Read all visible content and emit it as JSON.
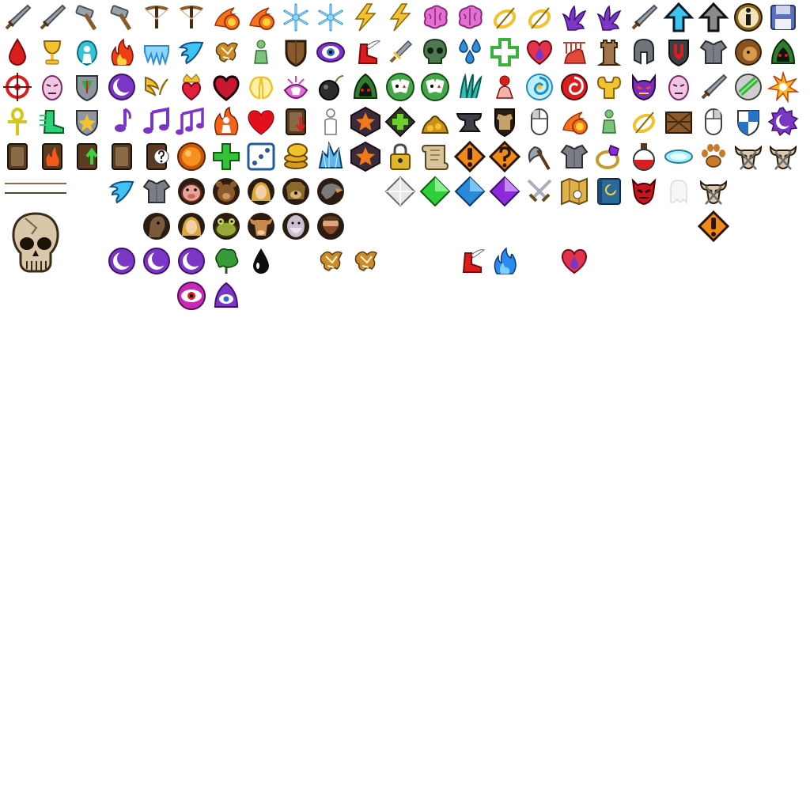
{
  "sheet": {
    "background": "#ffffff",
    "rows": [
      {
        "row": "row-1",
        "icons": [
          "sword-icon",
          "sword-icon",
          "hammer-icon",
          "hammer-icon",
          "crossbow-icon",
          "crossbow-icon",
          "fireball-icon",
          "fireball-icon",
          "snowflake-icon",
          "snowflake-icon",
          "lightning-icon",
          "lightning-icon",
          "brain-icon",
          "brain-icon",
          "ring-icon",
          "ring-icon",
          "coral-icon",
          "coral-icon",
          "sword-icon",
          "arrow-up-blue-icon",
          "arrow-up-gray-icon",
          "info-icon",
          "save-disk-icon"
        ]
      },
      {
        "row": "row-2",
        "icons": [
          "blood-drop-icon",
          "chalice-icon",
          "angel-icon",
          "fire-icon",
          "ice-icon",
          "wing-icon",
          "rune-icon",
          "figure-icon",
          "wooden-shield-icon",
          "eye-icon",
          "winged-boot-icon",
          "dagger-icon",
          "skull-icon",
          "water-drops-icon",
          "cross-icon",
          "heart-potion-icon",
          "torture-icon",
          "tower-icon",
          "helmet-icon",
          "banner-shield-icon",
          "armor-icon",
          "lion-icon",
          "hood-icon"
        ]
      },
      {
        "row": "row-3",
        "icons": [
          "target-icon",
          "face-icon",
          "shield-icon",
          "moon-icon",
          "wings-icon",
          "heart-crown-icon",
          "dark-heart-icon",
          "angel-wings-icon",
          "magic-hand-icon",
          "bomb-icon",
          "hood-icon",
          "cards-icon",
          "cards-icon",
          "feathers-icon",
          "stand-icon",
          "swirl-icon",
          "spiral-icon",
          "strength-icon",
          "demon-icon",
          "face-icon",
          "sword-icon",
          "chain-icon",
          "burst-icon"
        ]
      },
      {
        "row": "row-4",
        "icons": [
          "ankh-icon",
          "boot-icon",
          "shield-star-icon",
          "music-note-icon",
          "music-notes-icon",
          "music-triple-icon",
          "flame-figure-icon",
          "heart-icon",
          "card-down-icon",
          "silhouette-icon",
          "star-icon",
          "plus-diamond-icon",
          "gold-pile-icon",
          "anvil-icon",
          "armor-badge-icon",
          "mouse-left-icon",
          "fireball-icon",
          "figure-icon",
          "ring-icon",
          "crate-icon",
          "mouse-right-icon",
          "heater-shield-icon",
          "gear-moon-icon"
        ]
      },
      {
        "row": "row-5",
        "icons": [
          "card-icon",
          "card-fire-icon",
          "card-up-icon",
          "card-icon",
          "card-question-icon",
          "orb-icon",
          "plus-icon",
          "dice-icon",
          "coins-icon",
          "crystal-icon",
          "star-icon",
          "lock-icon",
          "scroll-icon",
          "alert-diamond-icon",
          "question-diamond-icon",
          "axe-icon",
          "armor-icon",
          "ring-gem-icon",
          "potion-icon",
          "portal-icon",
          "paw-icon",
          "bull-skull-icon",
          "bull-skull-icon"
        ]
      },
      {
        "row": "row-6",
        "icons": [
          "wing-icon",
          "armor-icon",
          "boar-icon",
          "bear-icon",
          "portrait-icon",
          "dog-icon",
          "vulture-icon",
          "gem-white-icon",
          "gem-green-icon",
          "gem-blue-icon",
          "gem-purple-icon",
          "crossed-swords-icon",
          "map-icon",
          "spellbook-icon",
          "demon-mask-icon",
          "ghost-icon",
          "bull-skull-icon"
        ]
      },
      {
        "row": "row-7",
        "icons": [
          "horse-icon",
          "portrait-icon",
          "toad-icon",
          "ox-icon",
          "elder-icon",
          "dwarf-icon",
          "alert-diamond-icon"
        ]
      },
      {
        "row": "row-8",
        "icons": [
          "moon-icon",
          "moon-icon",
          "moon-icon",
          "tree-icon",
          "ink-drop-icon",
          "rune-icon",
          "rune-icon",
          "winged-boot-icon",
          "blue-flame-icon",
          "heart-potion-icon"
        ]
      },
      {
        "row": "row-9",
        "icons": [
          "eye-orb-icon",
          "hood-eye-icon"
        ]
      }
    ],
    "colors": {
      "steel": "#9aa3ab",
      "steel_dark": "#4c5258",
      "wood": "#8a5a2b",
      "wood_dark": "#4a2e14",
      "fire": "#f7731b",
      "fire_core": "#ffd23a",
      "ice": "#8fd6ff",
      "ice_dark": "#2b8fd0",
      "gold": "#f2c12e",
      "gold_dark": "#8a6410",
      "pink": "#e36fd3",
      "purple": "#7b36c5",
      "purple_dark": "#3f1470",
      "blue": "#2f8ed8",
      "sky": "#3cc4f2",
      "red": "#d81e1e",
      "red_dark": "#7a0c0c",
      "green": "#3bb23b",
      "green_dark": "#1c5e1c",
      "bone": "#d9c7a9",
      "brown": "#6b4a2c",
      "black": "#1b1b1b",
      "card": "#5b3b22",
      "paper": "#d8c49a"
    }
  }
}
